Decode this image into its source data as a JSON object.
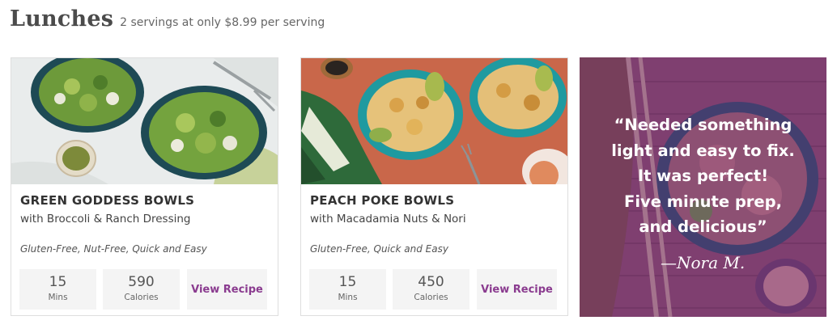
{
  "header": {
    "title": "Lunches",
    "subtitle": "2 servings at only $8.99 per serving"
  },
  "cards": [
    {
      "name": "GREEN GODDESS BOWLS",
      "subtitle": "with Broccoli & Ranch Dressing",
      "tags": "Gluten-Free, Nut-Free, Quick and Easy",
      "time_value": "15",
      "time_unit": "Mins",
      "calories_value": "590",
      "calories_unit": "Calories",
      "button_label": "View Recipe"
    },
    {
      "name": "PEACH POKE BOWLS",
      "subtitle": "with Macadamia Nuts & Nori",
      "tags": "Gluten-Free, Quick and Easy",
      "time_value": "15",
      "time_unit": "Mins",
      "calories_value": "450",
      "calories_unit": "Calories",
      "button_label": "View Recipe"
    }
  ],
  "testimonial": {
    "lines": [
      "“Needed something",
      "light and easy to fix.",
      "It was perfect!",
      "Five minute prep,",
      "and delicious”"
    ],
    "author": "—Nora M."
  },
  "colors": {
    "accent": "#8a3b8f",
    "panel_overlay": "#7a3e6e"
  }
}
